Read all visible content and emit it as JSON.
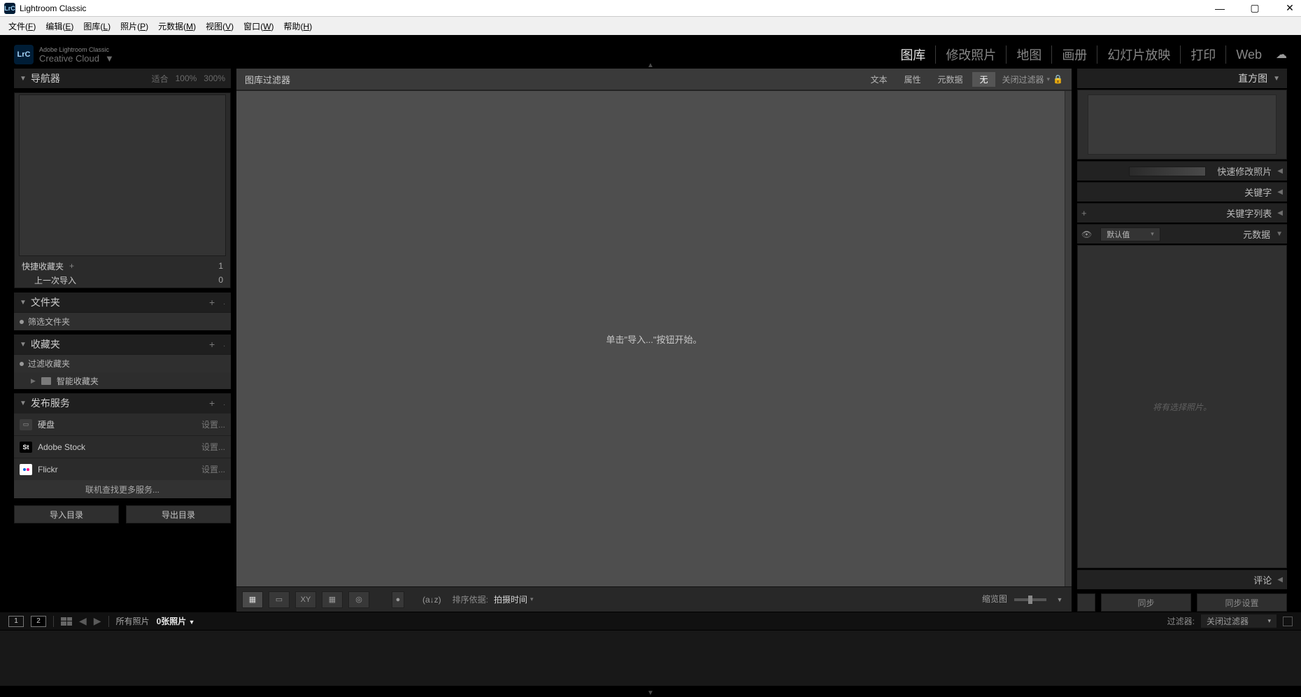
{
  "titlebar": {
    "app": "Lightroom Classic"
  },
  "menu": {
    "file": "文件",
    "file_k": "F",
    "edit": "编辑",
    "edit_k": "E",
    "library": "图库",
    "library_k": "L",
    "photo": "照片",
    "photo_k": "P",
    "metadata": "元数据",
    "metadata_k": "M",
    "view": "视图",
    "view_k": "V",
    "window": "窗口",
    "window_k": "W",
    "help": "帮助",
    "help_k": "H"
  },
  "header": {
    "brand_small": "Adobe Lightroom Classic",
    "brand": "Creative Cloud",
    "modules": {
      "library": "图库",
      "develop": "修改照片",
      "map": "地图",
      "book": "画册",
      "slideshow": "幻灯片放映",
      "print": "打印",
      "web": "Web"
    }
  },
  "left": {
    "navigator": "导航器",
    "fit": "适合",
    "p100": "100%",
    "p300": "300%",
    "quick_collection": "快捷收藏夹",
    "quick_count": "1",
    "last_import": "上一次导入",
    "last_count": "0",
    "folders": "文件夹",
    "filter_folders": "筛选文件夹",
    "collections": "收藏夹",
    "filter_collections": "过滤收藏夹",
    "smart": "智能收藏夹",
    "publish": "发布服务",
    "services": {
      "hdd": "硬盘",
      "stock": "Adobe Stock",
      "flickr": "Flickr",
      "setup": "设置..."
    },
    "more_services": "联机查找更多服务...",
    "import": "导入目录",
    "export": "导出目录"
  },
  "mid": {
    "filter_title": "图库过滤器",
    "tabs": {
      "text": "文本",
      "attr": "属性",
      "meta": "元数据",
      "none": "无"
    },
    "close_filter": "关闭过滤器",
    "hint": "单击\"导入...\"按钮开始。",
    "toolbar": {
      "sort_label": "排序依据:",
      "sort_value": "拍摄时间",
      "thumb": "缩览图"
    }
  },
  "right": {
    "histogram": "直方图",
    "quick_dev": "快速修改照片",
    "keywords": "关键字",
    "keyword_list": "关键字列表",
    "metadata": "元数据",
    "default": "默认值",
    "meta_hint": "将有选择照片。",
    "comments": "评论",
    "sync": "同步",
    "sync_settings": "同步设置"
  },
  "film": {
    "all_photos": "所有照片",
    "count": "0张照片",
    "filter": "过滤器:",
    "close_filter": "关闭过滤器"
  }
}
